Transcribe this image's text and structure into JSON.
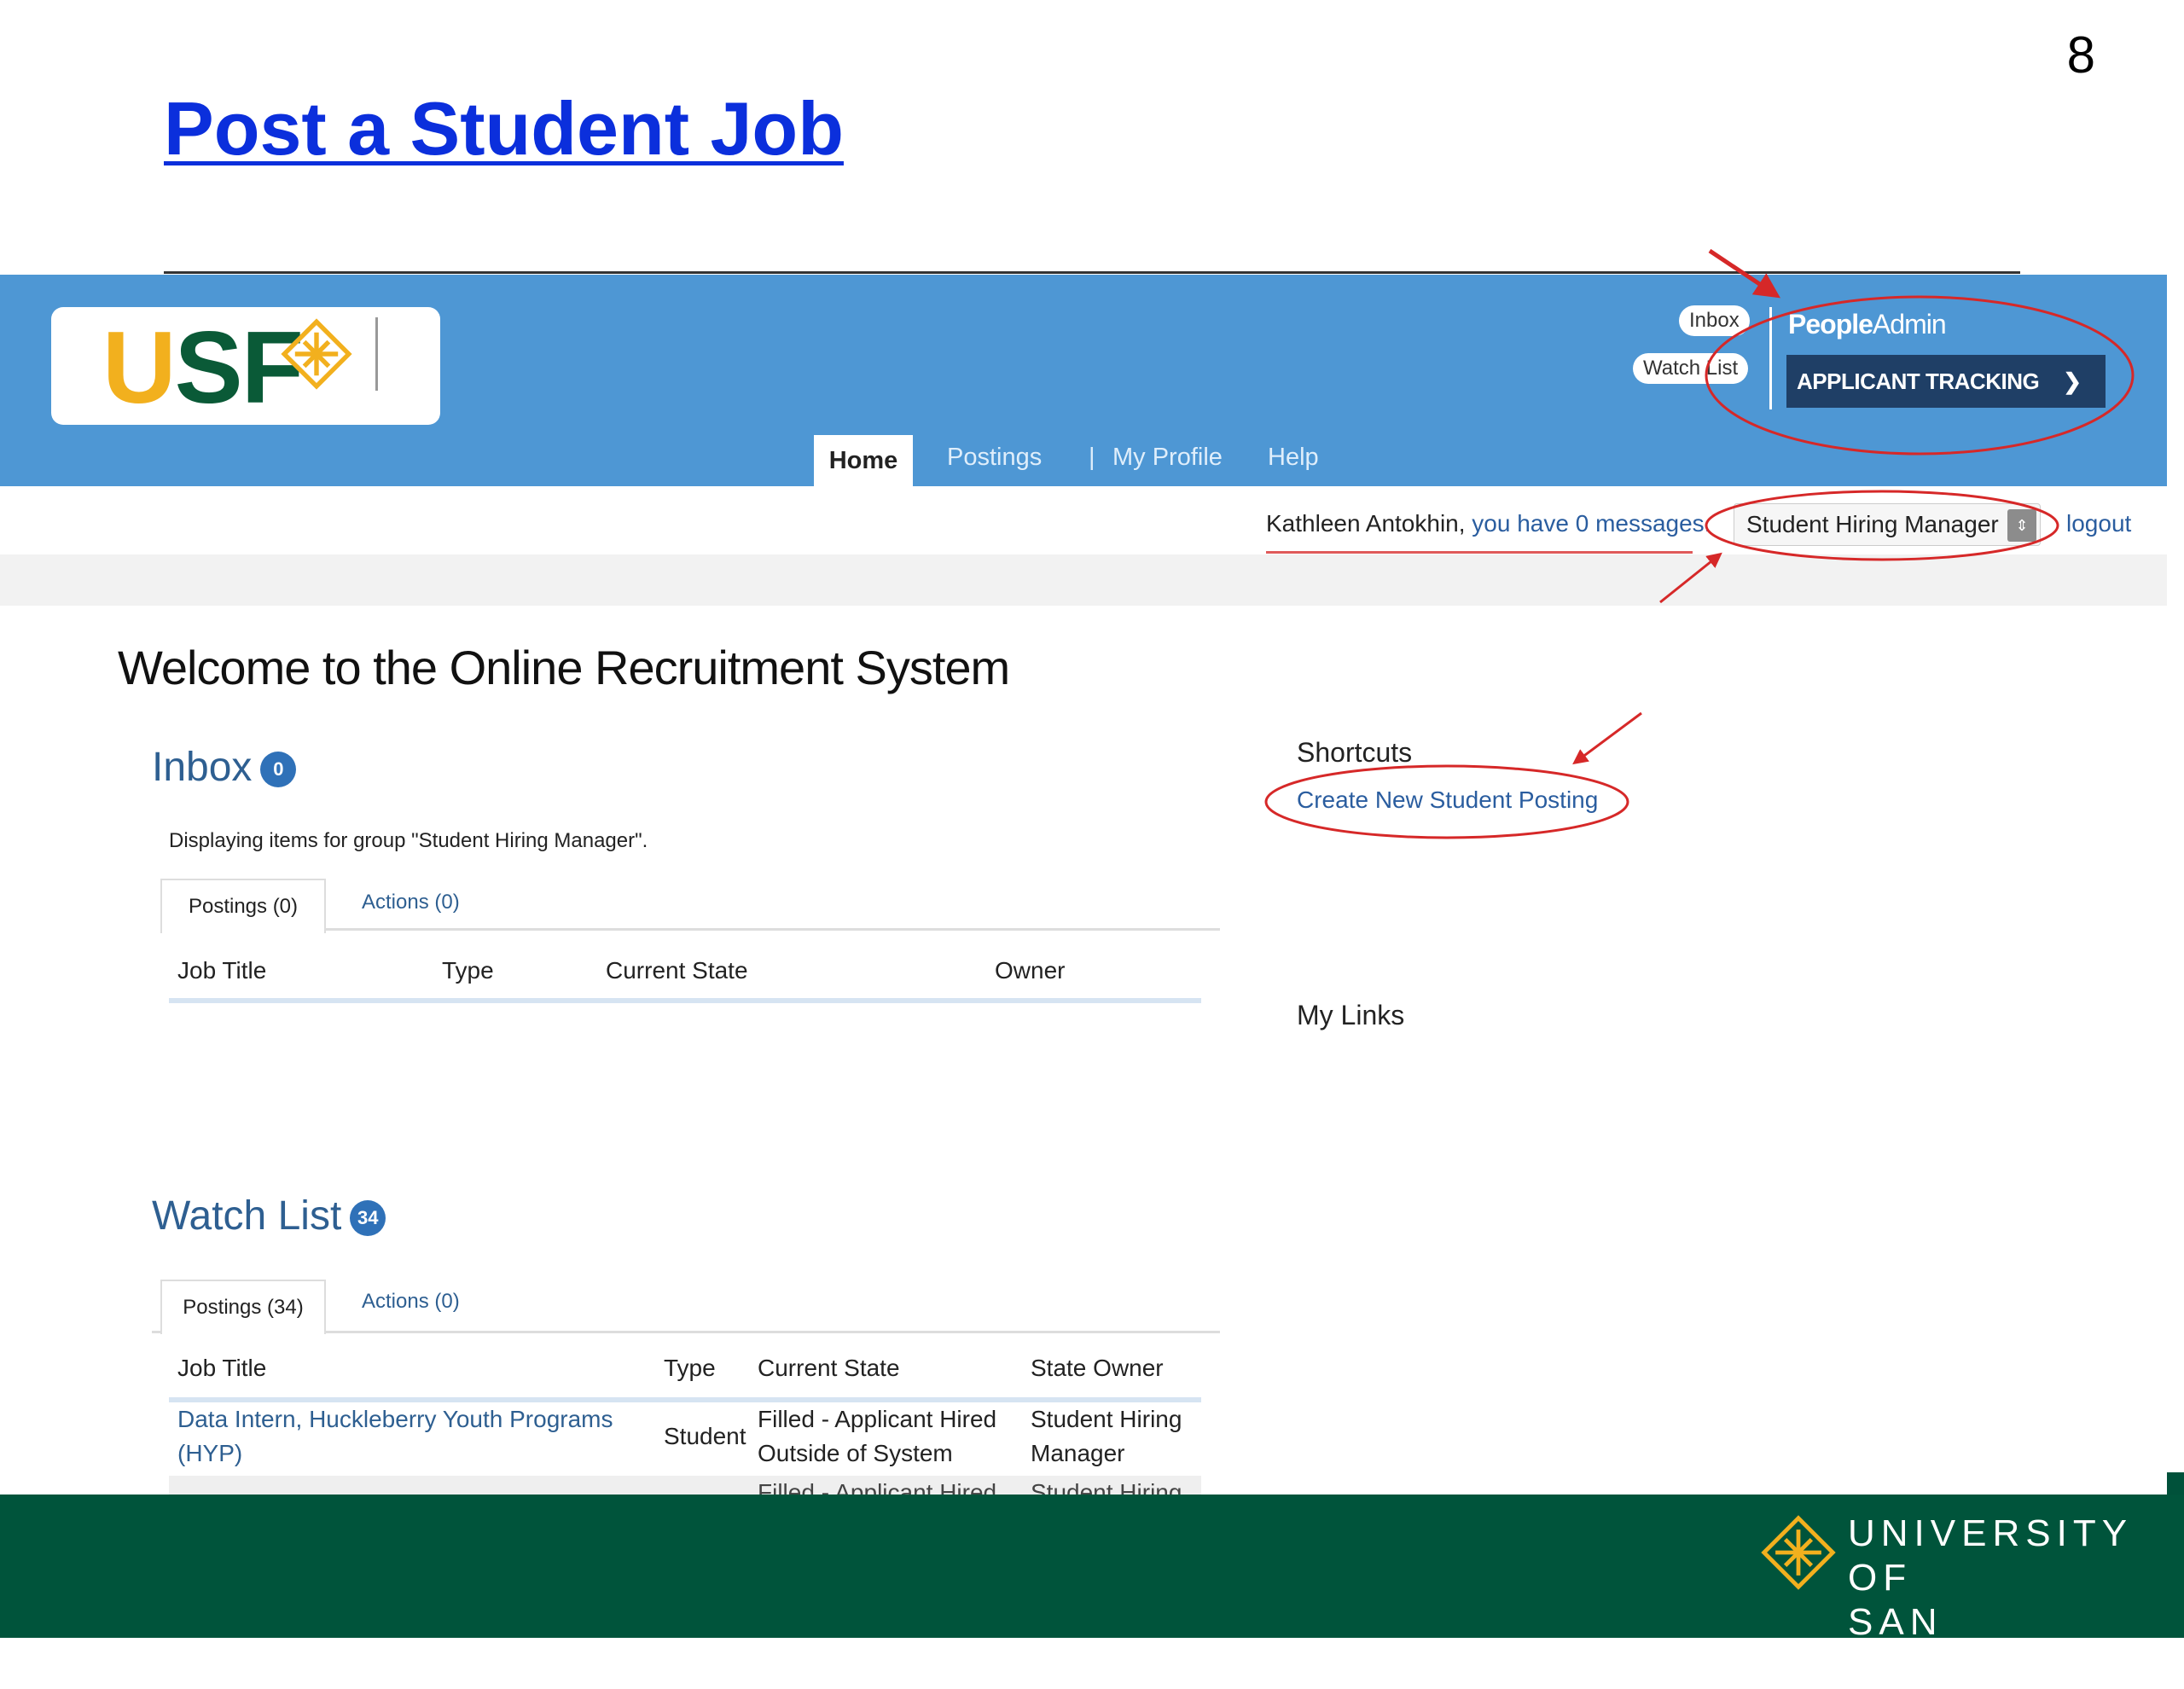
{
  "slide": {
    "number": "8",
    "title": "Post a Student Job"
  },
  "header": {
    "logo_text_u": "U",
    "logo_text_sf": "SF",
    "inbox_pill": "Inbox",
    "watchlist_pill": "Watch List",
    "peopleadmin_bold": "People",
    "peopleadmin_rest": "Admin",
    "app_select": "APPLICANT TRACKING"
  },
  "nav": {
    "home": "Home",
    "postings": "Postings",
    "sep": "|",
    "profile": "My Profile",
    "help": "Help"
  },
  "userbar": {
    "name": "Kathleen Antokhin, ",
    "messages": "you have 0 messages.",
    "role": "Student Hiring Manager",
    "logout": "logout"
  },
  "main": {
    "welcome": "Welcome to the Online Recruitment System",
    "inbox": {
      "heading": "Inbox",
      "count": "0",
      "description": "Displaying items for group \"Student Hiring Manager\".",
      "tab_postings": "Postings (0)",
      "tab_actions": "Actions (0)",
      "columns": [
        "Job Title",
        "Type",
        "Current State",
        "Owner"
      ]
    },
    "shortcuts": {
      "heading": "Shortcuts",
      "link": "Create New Student Posting"
    },
    "my_links": {
      "heading": "My Links"
    },
    "watch_list": {
      "heading": "Watch List",
      "count": "34",
      "tab_postings": "Postings (34)",
      "tab_actions": "Actions (0)",
      "columns": [
        "Job Title",
        "Type",
        "Current State",
        "State Owner"
      ],
      "rows": [
        {
          "title": "Data Intern, Huckleberry Youth Programs (HYP)",
          "type": "Student",
          "state": "Filled - Applicant Hired Outside of System",
          "owner": "Student Hiring Manager"
        },
        {
          "title": "",
          "type": "",
          "state": "Filled - Applicant Hired",
          "owner": "Student Hiring"
        }
      ]
    }
  },
  "footer": {
    "line1": "UNIVERSITY OF",
    "line2": "SAN FRANCISCO"
  },
  "colors": {
    "header_blue": "#4e97d4",
    "app_select_navy": "#1f3f66",
    "footer_green": "#00543b",
    "annotation_red": "#d62828",
    "title_blue": "#0b2fdc"
  }
}
